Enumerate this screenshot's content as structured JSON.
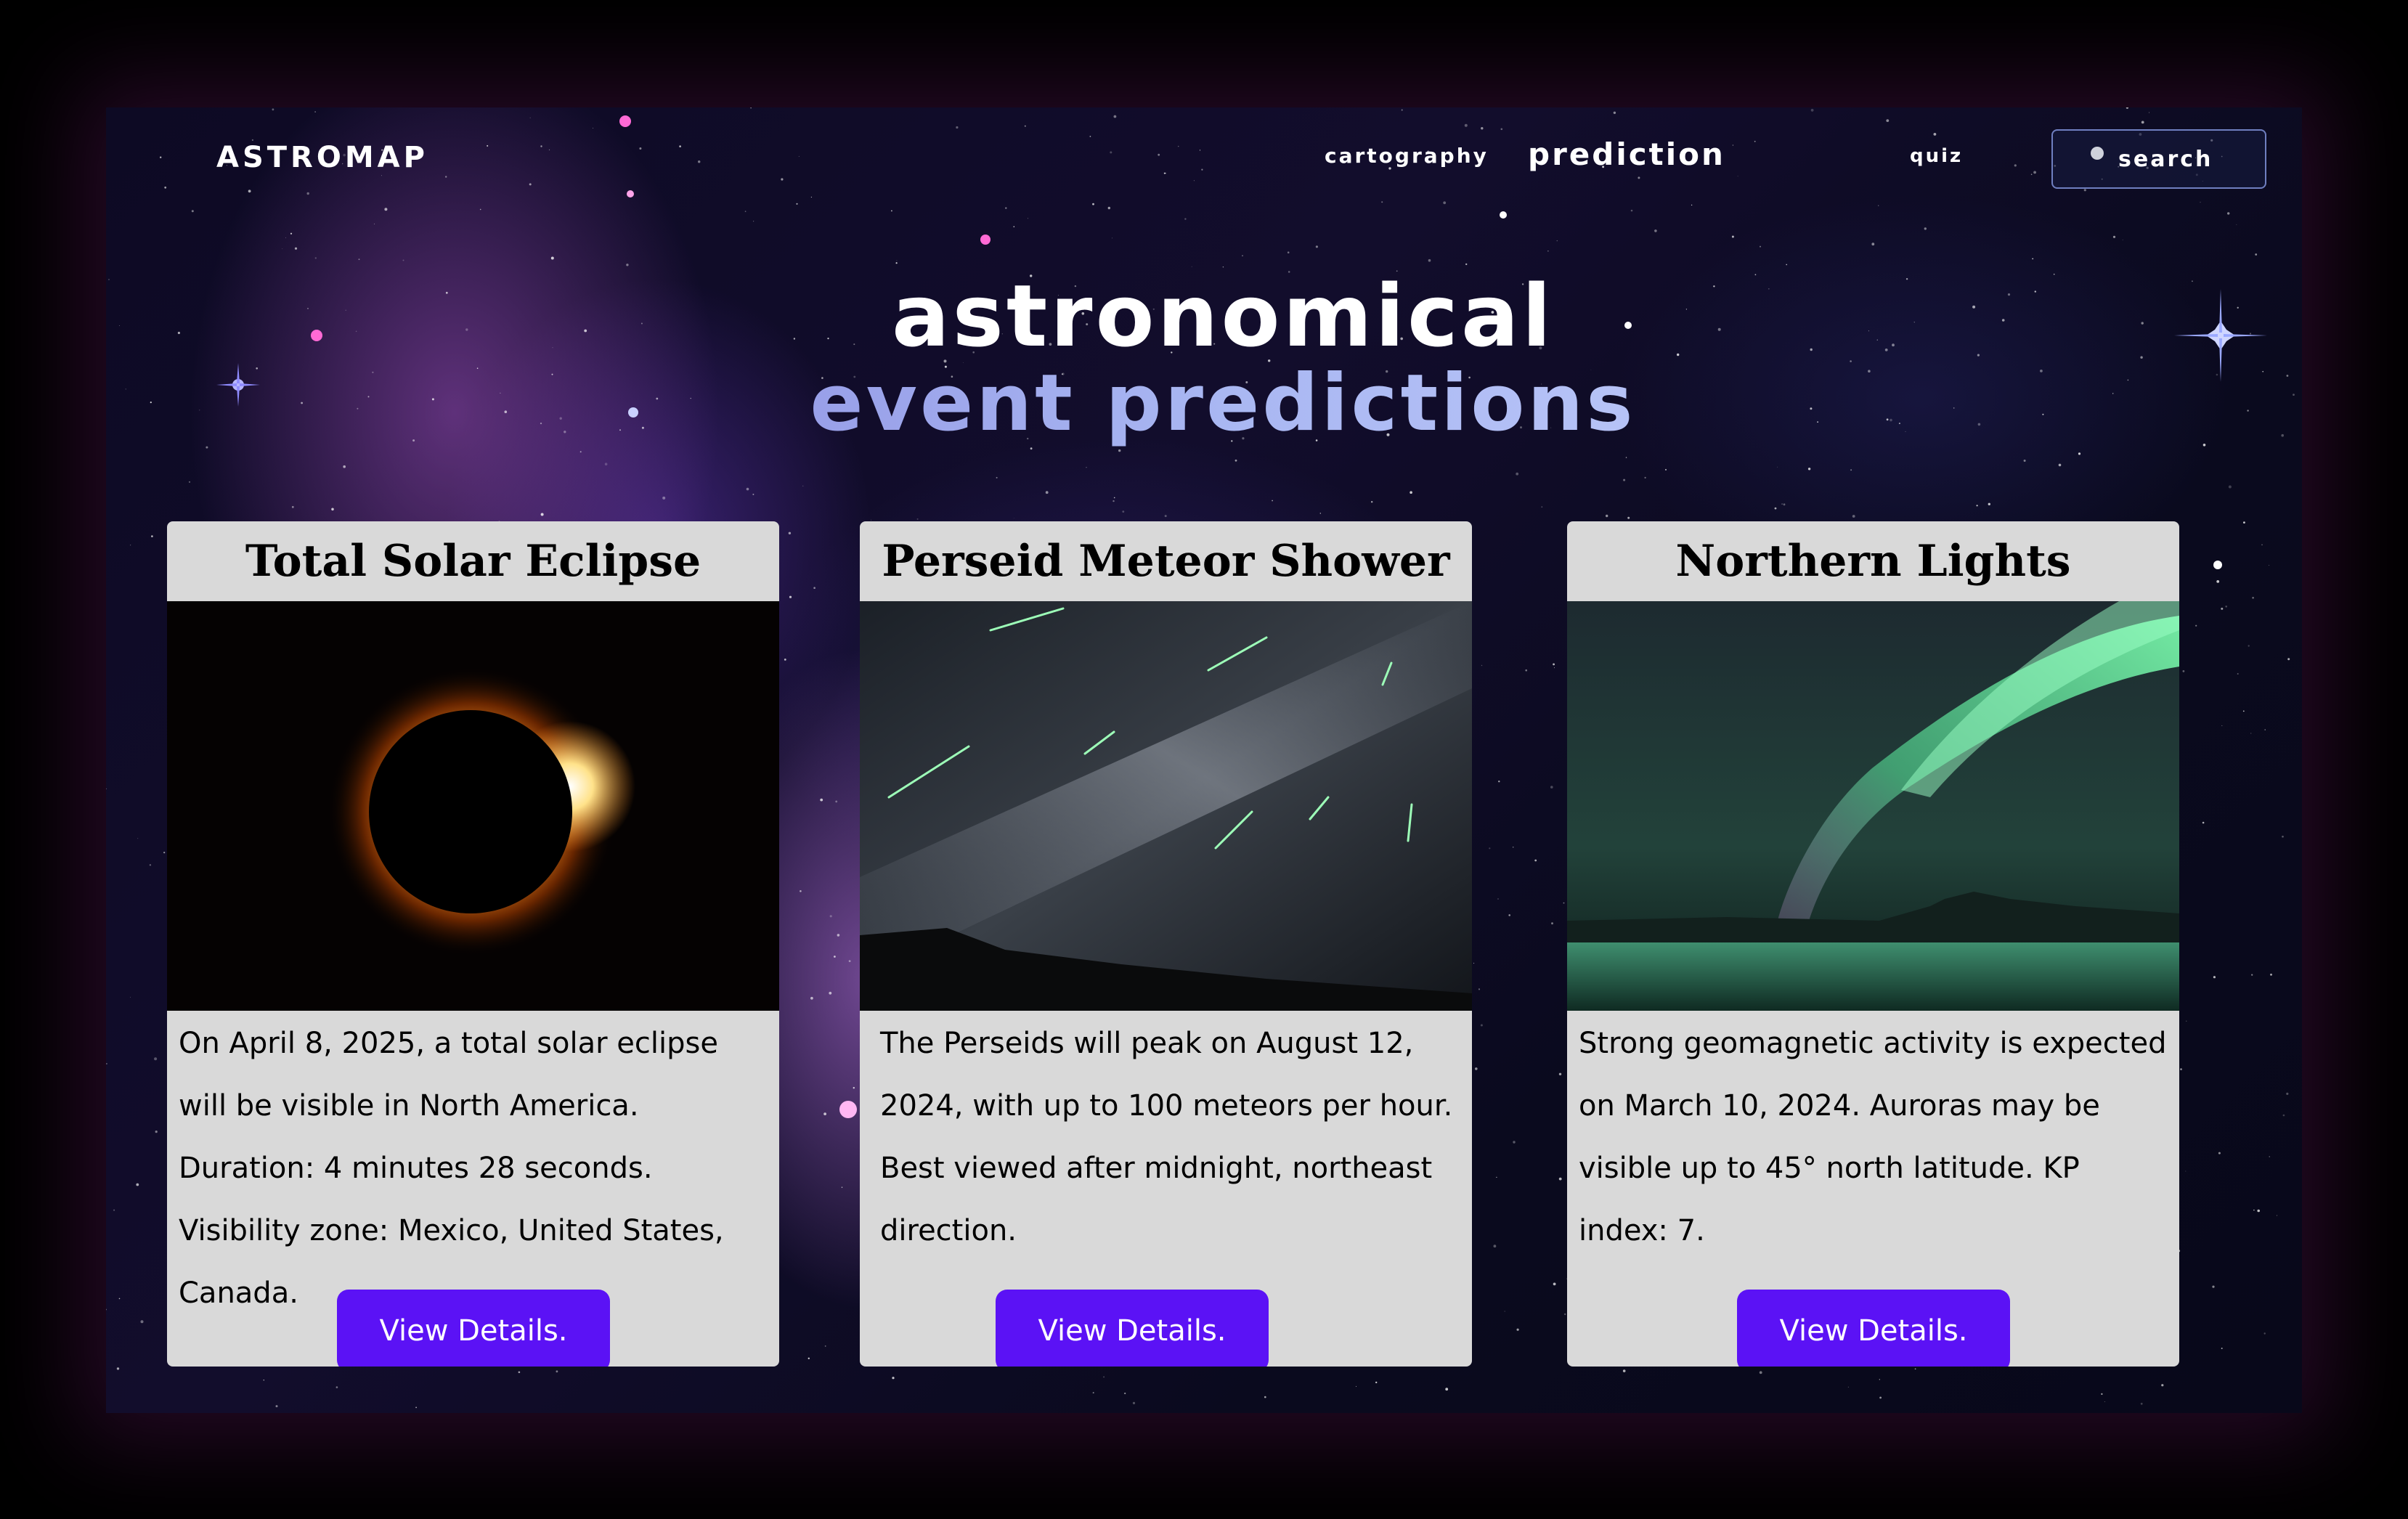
{
  "header": {
    "logo": "ASTROMAP",
    "nav": [
      "cartography",
      "prediction",
      "quiz"
    ],
    "search_label": "search"
  },
  "hero": {
    "line1": "astronomical",
    "line2": "event predictions"
  },
  "cards": [
    {
      "title": "Total Solar Eclipse",
      "text": "On April 8, 2025, a total solar eclipse will be visible in North America. Duration: 4 minutes 28 seconds. Visibility zone: Mexico, United States, Canada.",
      "button": "View Details.",
      "image": "solar-eclipse-photo"
    },
    {
      "title": "Perseid Meteor Shower",
      "text": "The Perseids will peak on August 12, 2024, with up to 100 meteors per hour. Best viewed after midnight, northeast direction.",
      "button": "View Details.",
      "image": "meteor-shower-photo"
    },
    {
      "title": "Northern Lights",
      "text": "Strong geomagnetic activity is expected on March 10, 2024. Auroras may be visible up to 45° north latitude. KP index: 7.",
      "button": "View Details.",
      "image": "aurora-photo"
    }
  ],
  "colors": {
    "button": "#5b12f5",
    "card": "#d9d9d9",
    "background": "#0d0a24",
    "accent": "#a9b7f2"
  }
}
